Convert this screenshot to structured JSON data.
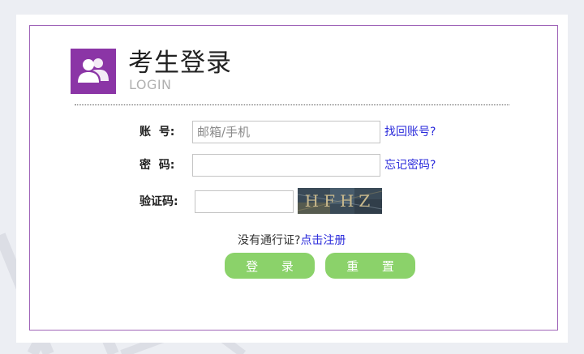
{
  "header": {
    "title": "考生登录",
    "subtitle": "LOGIN",
    "logo_icon": "users-icon",
    "logo_color": "#8b35a6"
  },
  "form": {
    "account_label": "账  号:",
    "account_placeholder": "邮箱/手机",
    "account_value": "",
    "forgot_account_link": "找回账号?",
    "password_label": "密  码:",
    "password_value": "",
    "forgot_password_link": "忘记密码?",
    "captcha_label": "验证码:",
    "captcha_value": "",
    "captcha_text": "HFHZ"
  },
  "register": {
    "prompt": "没有通行证?",
    "link": "点击注册"
  },
  "buttons": {
    "login": "登 录",
    "reset": "重 置",
    "accent": "#8bd26a"
  }
}
